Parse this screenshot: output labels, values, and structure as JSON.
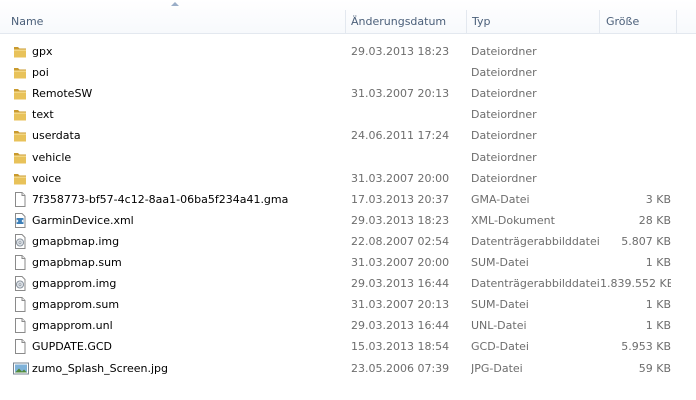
{
  "columns": {
    "name": "Name",
    "date": "Änderungsdatum",
    "type": "Typ",
    "size": "Größe"
  },
  "files": [
    {
      "name": "gpx",
      "date": "29.03.2013 18:23",
      "type": "Dateiordner",
      "size": "",
      "icon": "folder-icon"
    },
    {
      "name": "poi",
      "date": "",
      "type": "Dateiordner",
      "size": "",
      "icon": "folder-icon"
    },
    {
      "name": "RemoteSW",
      "date": "31.03.2007 20:13",
      "type": "Dateiordner",
      "size": "",
      "icon": "folder-icon"
    },
    {
      "name": "text",
      "date": "",
      "type": "Dateiordner",
      "size": "",
      "icon": "folder-icon"
    },
    {
      "name": "userdata",
      "date": "24.06.2011 17:24",
      "type": "Dateiordner",
      "size": "",
      "icon": "folder-icon"
    },
    {
      "name": "vehicle",
      "date": "",
      "type": "Dateiordner",
      "size": "",
      "icon": "folder-icon"
    },
    {
      "name": "voice",
      "date": "31.03.2007 20:00",
      "type": "Dateiordner",
      "size": "",
      "icon": "folder-icon"
    },
    {
      "name": "7f358773-bf57-4c12-8aa1-06ba5f234a41.gma",
      "date": "17.03.2013 20:37",
      "type": "GMA-Datei",
      "size": "3 KB",
      "icon": "file-icon"
    },
    {
      "name": "GarminDevice.xml",
      "date": "29.03.2013 18:23",
      "type": "XML-Dokument",
      "size": "28 KB",
      "icon": "xml-file-icon"
    },
    {
      "name": "gmapbmap.img",
      "date": "22.08.2007 02:54",
      "type": "Datenträgerabbilddatei",
      "size": "5.807 KB",
      "icon": "disc-image-icon"
    },
    {
      "name": "gmapbmap.sum",
      "date": "31.03.2007 20:00",
      "type": "SUM-Datei",
      "size": "1 KB",
      "icon": "file-icon"
    },
    {
      "name": "gmapprom.img",
      "date": "29.03.2013 16:44",
      "type": "Datenträgerabbilddatei",
      "size": "1.839.552 KB",
      "icon": "disc-image-icon"
    },
    {
      "name": "gmapprom.sum",
      "date": "31.03.2007 20:13",
      "type": "SUM-Datei",
      "size": "1 KB",
      "icon": "file-icon"
    },
    {
      "name": "gmapprom.unl",
      "date": "29.03.2013 16:44",
      "type": "UNL-Datei",
      "size": "1 KB",
      "icon": "file-icon"
    },
    {
      "name": "GUPDATE.GCD",
      "date": "15.03.2013 18:54",
      "type": "GCD-Datei",
      "size": "5.953 KB",
      "icon": "file-icon"
    },
    {
      "name": "zumo_Splash_Screen.jpg",
      "date": "23.05.2006 07:39",
      "type": "JPG-Datei",
      "size": "59 KB",
      "icon": "image-file-icon"
    }
  ],
  "colors": {
    "folder": "#e8c25a",
    "folder_dark": "#c99a2e",
    "header_text": "#4c607a",
    "secondary_text": "#6d6d6d"
  }
}
